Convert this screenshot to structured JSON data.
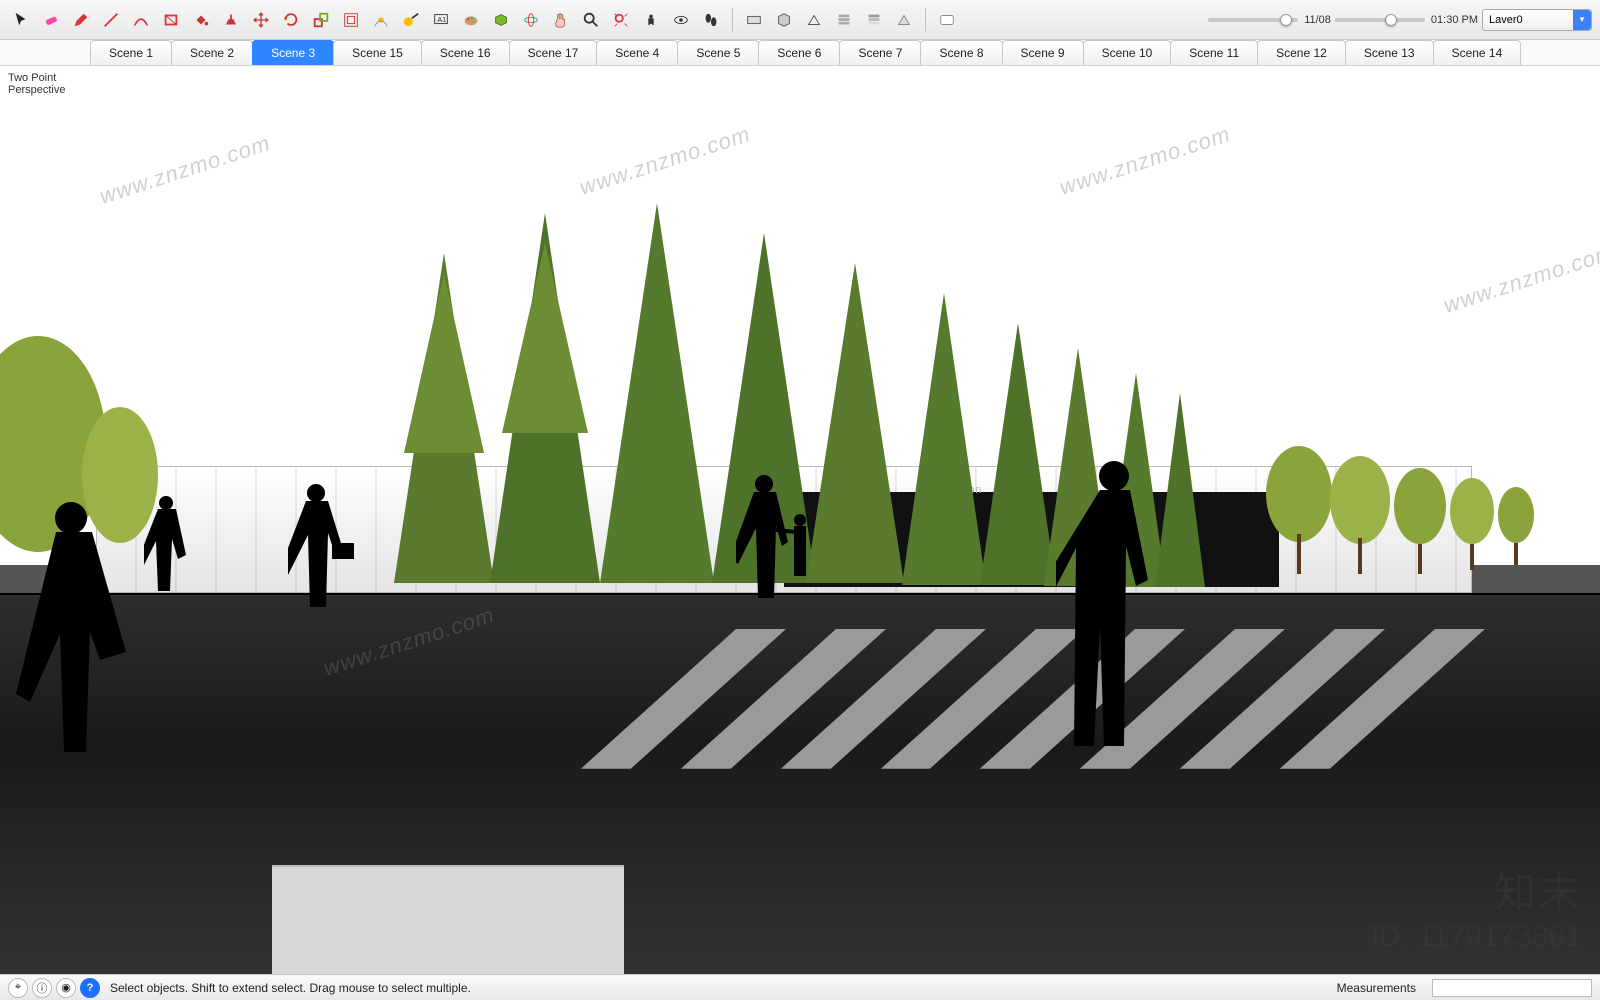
{
  "toolbar": {
    "date": "11/08",
    "time": "01:30 PM",
    "layer": "Laver0",
    "icons": [
      "select-arrow-icon",
      "eraser-icon",
      "pencil-icon",
      "line-icon",
      "arc-icon",
      "rectangle-icon",
      "paint-bucket-icon",
      "pushpull-icon",
      "move-icon",
      "rotate-icon",
      "scale-icon",
      "offset-icon",
      "follow-me-icon",
      "tape-measure-icon",
      "text-icon",
      "paint-icon",
      "component-icon",
      "orbit-icon",
      "pan-icon",
      "zoom-icon",
      "zoom-extents-icon",
      "position-camera-icon",
      "look-around-icon",
      "walk-icon",
      "section-icon",
      "section-display-icon",
      "outliner-icon",
      "layers-icon",
      "shadows-icon",
      "fog-icon",
      "xray-icon"
    ]
  },
  "scenes": {
    "active": 2,
    "tabs": [
      "Scene 1",
      "Scene 2",
      "Scene 3",
      "Scene 15",
      "Scene 16",
      "Scene 17",
      "Scene 4",
      "Scene 5",
      "Scene 6",
      "Scene 7",
      "Scene 8",
      "Scene 9",
      "Scene 10",
      "Scene 11",
      "Scene 12",
      "Scene 13",
      "Scene 14"
    ]
  },
  "viewport": {
    "camera_label_line1": "Two Point",
    "camera_label_line2": "Perspective",
    "building_sign": "us Station"
  },
  "status": {
    "hint": "Select objects. Shift to extend select. Drag mouse to select multiple.",
    "measurements_label": "Measurements"
  },
  "watermark": {
    "url": "www.znzmo.com",
    "brand": "知末",
    "id": "ID: 1179173361"
  }
}
